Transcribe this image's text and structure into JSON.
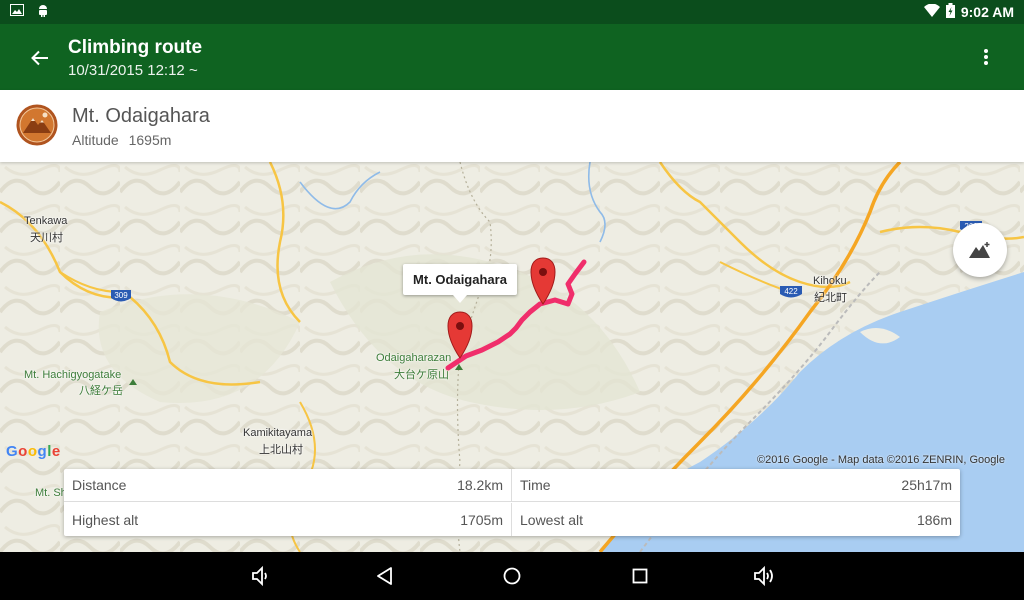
{
  "status_bar": {
    "time": "9:02 AM",
    "battery_icon": "battery-icon",
    "wifi_icon": "wifi-icon"
  },
  "app_bar": {
    "title": "Climbing route",
    "subtitle": "10/31/2015 12:12  ~"
  },
  "mountain": {
    "name": "Mt. Odaigahara",
    "altitude_label": "Altitude",
    "altitude_value": "1695m"
  },
  "map": {
    "callout": "Mt. Odaigahara",
    "labels": {
      "tenkawa": "Tenkawa",
      "tenkawa_jp": "天川村",
      "kihoku": "Kihoku",
      "kihoku_jp": "紀北町",
      "odaigaharazan": "Odaigaharazan",
      "odaigaharazan_jp": "大台ケ原山",
      "hachigyogatake": "Mt. Hachigyogatake",
      "hachigyogatake_jp": "八経ケ岳",
      "kamikitayama": "Kamikitayama",
      "kamikitayama_jp": "上北山村",
      "mt_sh": "Mt. Sh",
      "route_309": "309",
      "route_422": "422",
      "route_260": "260"
    },
    "attribution": "©2016 Google - Map data ©2016 ZENRIN, Google",
    "google_logo": "Google",
    "route_color": "#f02e6b"
  },
  "stats": {
    "distance_label": "Distance",
    "distance_value": "18.2km",
    "time_label": "Time",
    "time_value": "25h17m",
    "highest_label": "Highest alt",
    "highest_value": "1705m",
    "lowest_label": "Lowest alt",
    "lowest_value": "186m"
  },
  "colors": {
    "status_bar": "#0b4d1c",
    "app_bar": "#0f6321",
    "water": "#a9cdf2",
    "road": "#f7c544",
    "marker": "#e53935"
  }
}
